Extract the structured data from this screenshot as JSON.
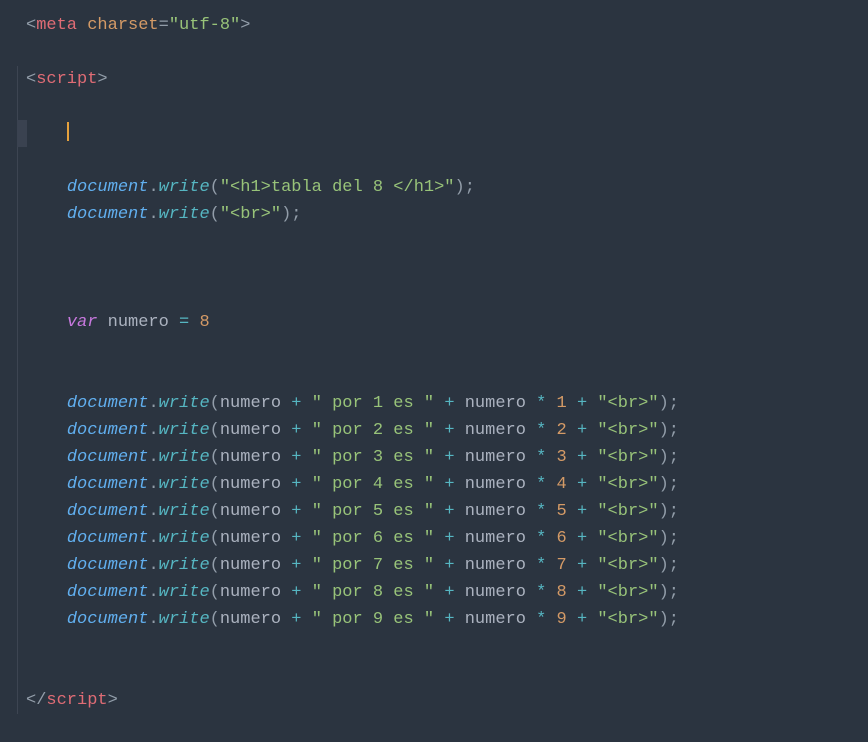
{
  "code": {
    "metaOpen": "<",
    "metaTag": "meta",
    "metaAttr": "charset",
    "metaEq": "=",
    "metaVal": "\"utf-8\"",
    "metaClose": ">",
    "scriptOpen": "<",
    "scriptTag": "script",
    "scriptClose": ">",
    "scriptCloseOpen": "</",
    "documentObj": "document",
    "dot": ".",
    "writeMethod": "write",
    "openParen": "(",
    "closeParen": ")",
    "semi": ";",
    "str_h1": "\"<h1>tabla del 8 </h1>\"",
    "str_br": "\"<br>\"",
    "varKw": "var",
    "space": " ",
    "numeroIdent": "numero",
    "eq": "=",
    "eight": "8",
    "plus": "+",
    "star": "*",
    "str_por1": "\" por 1 es \"",
    "str_por2": "\" por 2 es \"",
    "str_por3": "\" por 3 es \"",
    "str_por4": "\" por 4 es \"",
    "str_por5": "\" por 5 es \"",
    "str_por6": "\" por 6 es \"",
    "str_por7": "\" por 7 es \"",
    "str_por8": "\" por 8 es \"",
    "str_por9": "\" por 9 es \"",
    "n1": "1",
    "n2": "2",
    "n3": "3",
    "n4": "4",
    "n5": "5",
    "n6": "6",
    "n7": "7",
    "n8": "8",
    "n9": "9",
    "str_brend": "\"<br>\"",
    "indent4": "    "
  }
}
